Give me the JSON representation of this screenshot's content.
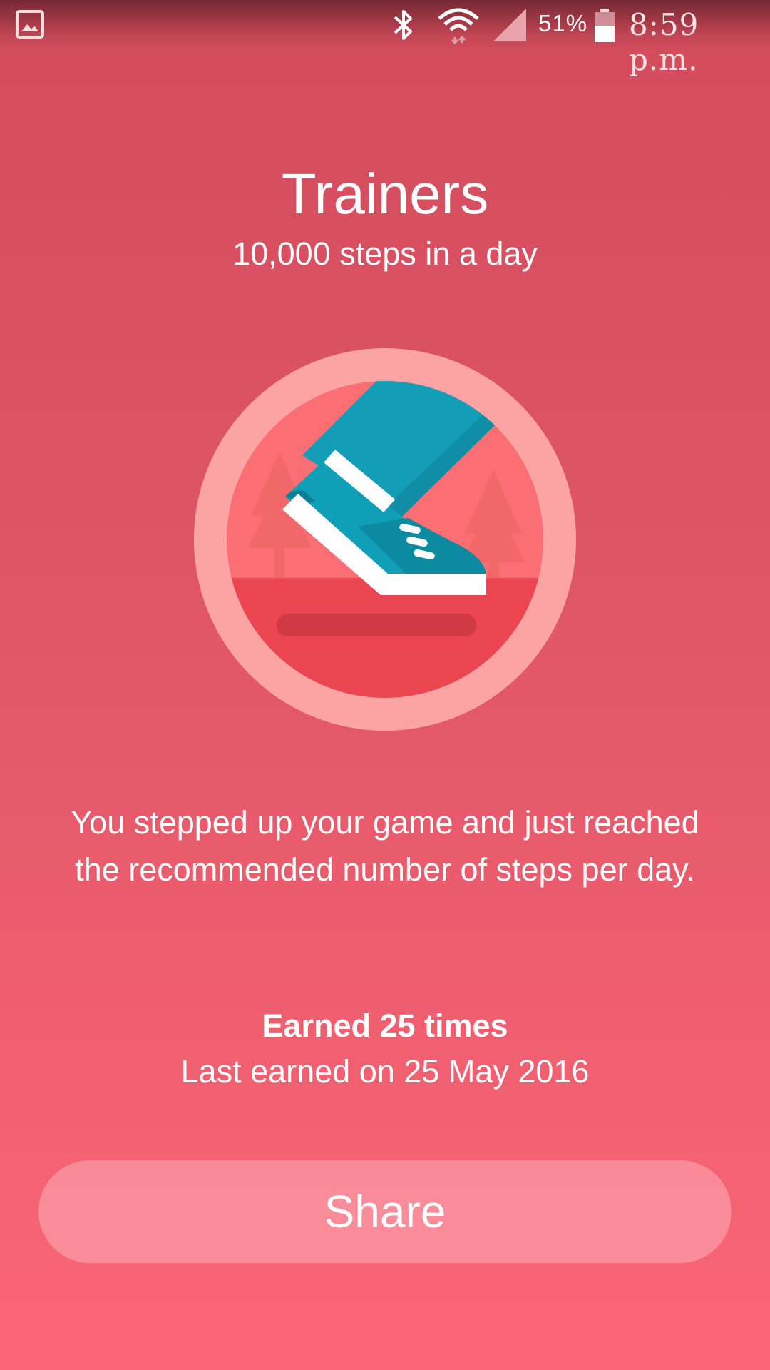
{
  "status_bar": {
    "battery_percent": "51%",
    "time": "8:59 p.m.",
    "icons": [
      "gallery-icon",
      "bluetooth-icon",
      "wifi-icon",
      "signal-icon",
      "battery-icon"
    ]
  },
  "badge": {
    "title": "Trainers",
    "subtitle": "10,000 steps in a day",
    "illustration": "sneaker-step-icon",
    "description": "You stepped up your game and just reached the recommended number of steps per day.",
    "earned_count": "Earned 25 times",
    "last_earned": "Last earned on 25 May 2016"
  },
  "actions": {
    "share_label": "Share"
  },
  "colors": {
    "background_top": "#d34c5c",
    "background_bottom": "#fb6677",
    "badge_ring": "#fca4a4",
    "badge_sky": "#fb6e74",
    "badge_ground": "#ea4550",
    "pant": "#149db7",
    "shoe": "#0f9fb7",
    "share_button": "#fa8f9c"
  }
}
